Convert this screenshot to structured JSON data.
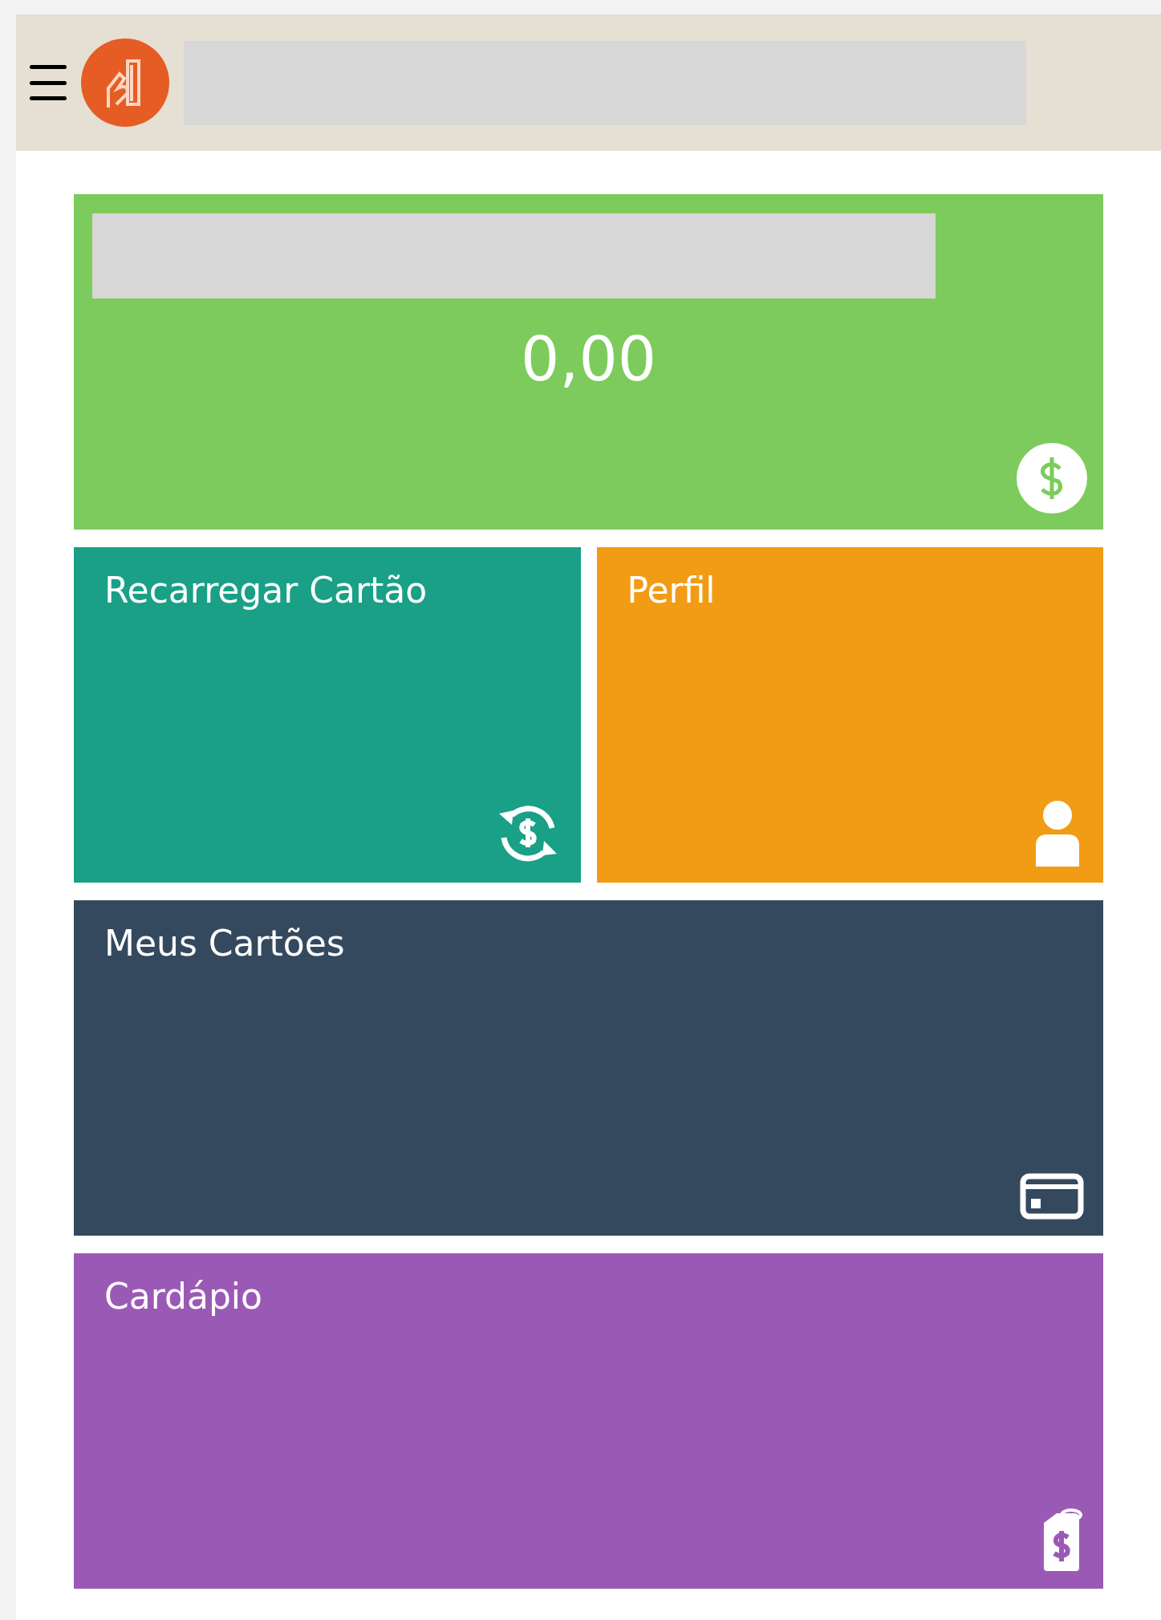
{
  "balance": {
    "amount": "0,00",
    "color": "#7dcb5c"
  },
  "tiles": [
    {
      "label": "Recarregar Cartão",
      "color": "#19a087"
    },
    {
      "label": "Perfil",
      "color": "#f19c14"
    },
    {
      "label": "Meus Cartões",
      "color": "#34495e"
    },
    {
      "label": "Cardápio",
      "color": "#9b59b6"
    }
  ]
}
